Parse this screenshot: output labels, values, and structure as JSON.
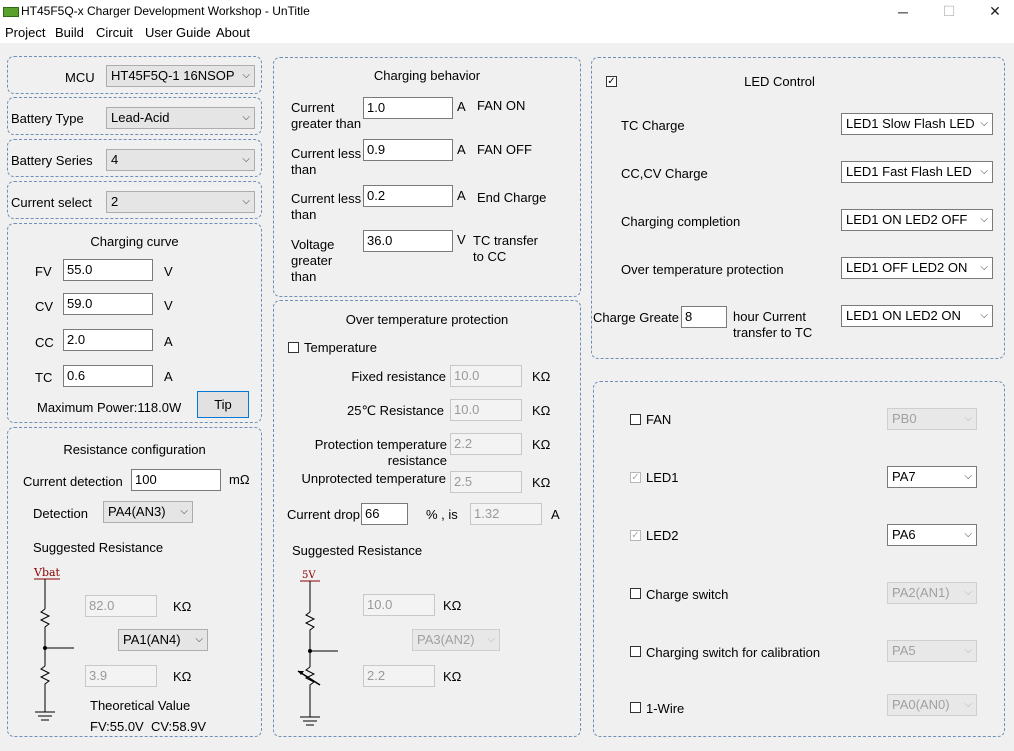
{
  "window": {
    "title": "HT45F5Q-x Charger Development Workshop - UnTitle",
    "minimize": "─",
    "maximize": "☐",
    "close": "✕"
  },
  "menu": [
    "Project",
    "Build",
    "Circuit",
    "User Guide",
    "About"
  ],
  "mcu": {
    "label": "MCU",
    "value": "HT45F5Q-1 16NSOP"
  },
  "battery_type": {
    "label": "Battery Type",
    "value": "Lead-Acid"
  },
  "battery_series": {
    "label": "Battery Series",
    "value": "4"
  },
  "current_select": {
    "label": "Current select",
    "value": "2"
  },
  "curve": {
    "title": "Charging curve",
    "fv": {
      "label": "FV",
      "value": "55.0",
      "unit": "V"
    },
    "cv": {
      "label": "CV",
      "value": "59.0",
      "unit": "V"
    },
    "cc": {
      "label": "CC",
      "value": "2.0",
      "unit": "A"
    },
    "tc": {
      "label": "TC",
      "value": "0.6",
      "unit": "A"
    },
    "max_power": "Maximum Power:118.0W",
    "tip": "Tip"
  },
  "resistance": {
    "title": "Resistance configuration",
    "current_detection_label": "Current detection",
    "current_detection_value": "100",
    "current_detection_unit": "mΩ",
    "detection_label": "Detection",
    "detection_value": "PA4(AN3)",
    "suggested": "Suggested Resistance",
    "vbat": "Vbat",
    "r1": "82.0",
    "r1_unit": "KΩ",
    "pin": "PA1(AN4)",
    "r2": "3.9",
    "r2_unit": "KΩ",
    "theoretical": "Theoretical Value",
    "theoretical_values": "FV:55.0V  CV:58.9V"
  },
  "behavior": {
    "title": "Charging behavior",
    "rows": [
      {
        "label": "Current greater than",
        "value": "1.0",
        "unit": "A",
        "action": "FAN ON"
      },
      {
        "label": "Current less than",
        "value": "0.9",
        "unit": "A",
        "action": "FAN OFF"
      },
      {
        "label": "Current less than",
        "value": "0.2",
        "unit": "A",
        "action": "End Charge"
      },
      {
        "label": "Voltage greater than",
        "value": "36.0",
        "unit": "V",
        "action": "TC transfer to CC"
      }
    ]
  },
  "otp": {
    "title": "Over temperature protection",
    "temperature": "Temperature",
    "fixed_label": "Fixed resistance",
    "fixed_value": "10.0",
    "r25_label": "25℃ Resistance",
    "r25_value": "10.0",
    "prot_label": "Protection temperature resistance",
    "prot_value": "2.2",
    "unprot_label": "Unprotected temperature",
    "unprot_value": "2.5",
    "unit": "KΩ",
    "drop_label": "Current drop",
    "drop_value": "66",
    "drop_unit": "% , is",
    "drop_result": "1.32",
    "drop_result_unit": "A",
    "suggested": "Suggested Resistance",
    "v5": "5V",
    "r1": "10.0",
    "pin": "PA3(AN2)",
    "r2": "2.2"
  },
  "led": {
    "title": "LED Control",
    "rows": [
      {
        "label": "TC Charge",
        "value": "LED1 Slow Flash LED"
      },
      {
        "label": "CC,CV Charge",
        "value": "LED1 Fast Flash LED"
      },
      {
        "label": "Charging completion",
        "value": "LED1 ON LED2 OFF"
      },
      {
        "label": "Over temperature protection",
        "value": "LED1 OFF LED2 ON"
      }
    ],
    "charge_greater_label": "Charge Greate",
    "charge_greater_value": "8",
    "hour_text": "hour Current transfer to TC",
    "last_value": "LED1 ON LED2 ON"
  },
  "io": [
    {
      "label": "FAN",
      "checked": false,
      "disabled": false,
      "pin": "PB0",
      "pin_disabled": true
    },
    {
      "label": "LED1",
      "checked": true,
      "disabled": true,
      "pin": "PA7",
      "pin_disabled": false
    },
    {
      "label": "LED2",
      "checked": true,
      "disabled": true,
      "pin": "PA6",
      "pin_disabled": false
    },
    {
      "label": "Charge switch",
      "checked": false,
      "disabled": false,
      "pin": "PA2(AN1)",
      "pin_disabled": true
    },
    {
      "label": "Charging switch for calibration",
      "checked": false,
      "disabled": false,
      "pin": "PA5",
      "pin_disabled": true
    },
    {
      "label": "1-Wire",
      "checked": false,
      "disabled": false,
      "pin": "PA0(AN0)",
      "pin_disabled": true
    }
  ],
  "glyphs": {
    "arrow": "⌵",
    "check": "✓"
  }
}
